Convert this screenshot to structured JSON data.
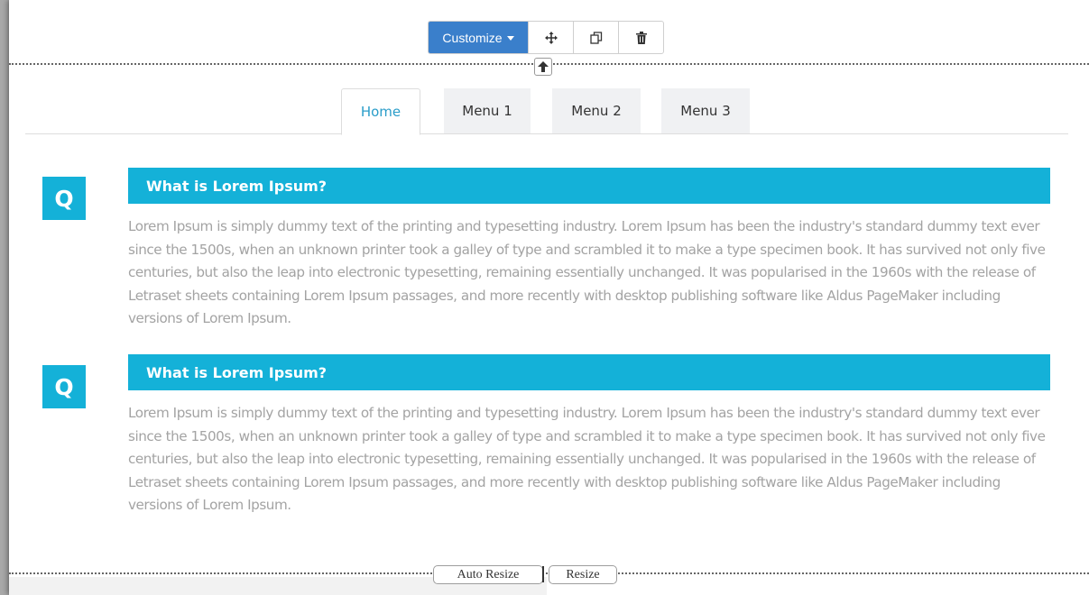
{
  "toolbar": {
    "customize_label": "Customize",
    "move_icon": "move-arrows-icon",
    "copy_icon": "copy-icon",
    "delete_icon": "trash-icon"
  },
  "tabs": [
    {
      "label": "Home",
      "active": true
    },
    {
      "label": "Menu 1",
      "active": false
    },
    {
      "label": "Menu 2",
      "active": false
    },
    {
      "label": "Menu 3",
      "active": false
    }
  ],
  "faq": [
    {
      "badge": "Q",
      "title": "What is Lorem Ipsum?",
      "text": "Lorem Ipsum is simply dummy text of the printing and typesetting industry. Lorem Ipsum has been the industry's standard dummy text ever since the 1500s, when an unknown printer took a galley of type and scrambled it to make a type specimen book. It has survived not only five centuries, but also the leap into electronic typesetting, remaining essentially unchanged. It was popularised in the 1960s with the release of Letraset sheets containing Lorem Ipsum passages, and more recently with desktop publishing software like Aldus PageMaker including versions of Lorem Ipsum."
    },
    {
      "badge": "Q",
      "title": "What is Lorem Ipsum?",
      "text": "Lorem Ipsum is simply dummy text of the printing and typesetting industry. Lorem Ipsum has been the industry's standard dummy text ever since the 1500s, when an unknown printer took a galley of type and scrambled it to make a type specimen book. It has survived not only five centuries, but also the leap into electronic typesetting, remaining essentially unchanged. It was popularised in the 1960s with the release of Letraset sheets containing Lorem Ipsum passages, and more recently with desktop publishing software like Aldus PageMaker including versions of Lorem Ipsum."
    }
  ],
  "bottom": {
    "auto_resize_label": "Auto Resize",
    "resize_label": "Resize"
  },
  "colors": {
    "accent": "#14b1d8",
    "customize_bg": "#3a7fcb",
    "active_tab_text": "#2a9dc9",
    "body_text": "#a3a3a3"
  }
}
